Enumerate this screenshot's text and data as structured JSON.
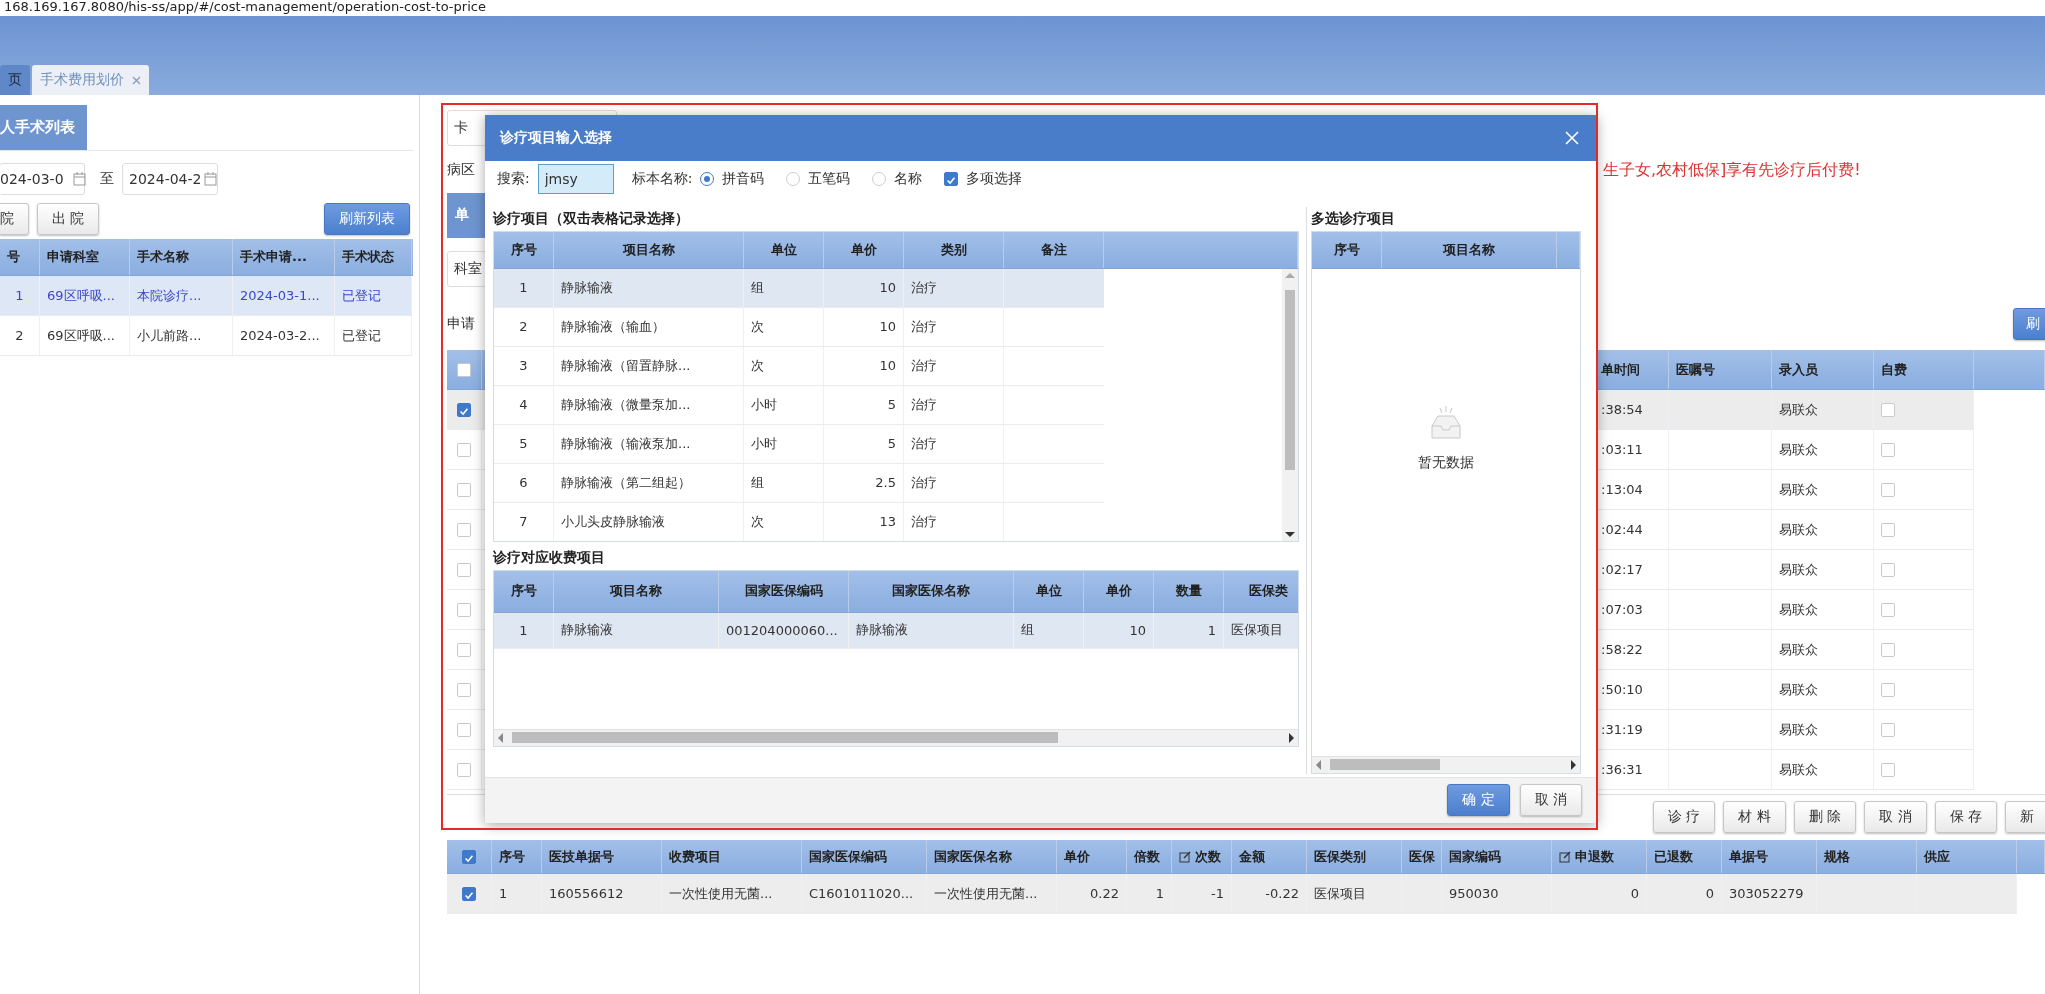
{
  "address_bar": {
    "url": "168.169.167.8080/his-ss/app/#/cost-management/operation-cost-to-price"
  },
  "tabs": [
    {
      "label": "页",
      "selected": false,
      "closable": false
    },
    {
      "label": "手术费用划价",
      "selected": true,
      "closable": true
    }
  ],
  "patient_panel": {
    "title": "人手术列表",
    "date_from": "024-03-0",
    "date_separator": "至",
    "date_to": "2024-04-2",
    "filter_buttons": [
      "院",
      "出 院"
    ],
    "refresh_button": "刷新列表",
    "table": {
      "columns": [
        "号",
        "申请科室",
        "手术名称",
        "手术申请...",
        "手术状态"
      ],
      "rows": [
        {
          "cells": [
            "1",
            "69区呼吸...",
            "本院诊疗...",
            "2024-03-1...",
            "已登记"
          ],
          "selected": true
        },
        {
          "cells": [
            "2",
            "69区呼吸...",
            "小儿前路...",
            "2024-03-2...",
            "已登记"
          ],
          "selected": false
        }
      ]
    }
  },
  "billing": {
    "card_field": "卡",
    "ward_label": "病区",
    "notice": "生子女,农村低保]享有先诊疗后付费!",
    "section_tab": "单",
    "dept_field": "科室",
    "apply_label": "申请",
    "refresh_button": "刷",
    "records": {
      "all_checked": false,
      "columns": [
        "单时间",
        "医嘱号",
        "录入员",
        "自费"
      ],
      "rows": [
        {
          "checked": true,
          "selected": true,
          "time": ":38:54",
          "recorder": "易联众",
          "self_pay": false
        },
        {
          "checked": false,
          "selected": false,
          "time": ":03:11",
          "recorder": "易联众",
          "self_pay": false
        },
        {
          "checked": false,
          "selected": false,
          "time": ":13:04",
          "recorder": "易联众",
          "self_pay": false
        },
        {
          "checked": false,
          "selected": false,
          "time": ":02:44",
          "recorder": "易联众",
          "self_pay": false
        },
        {
          "checked": false,
          "selected": false,
          "time": ":02:17",
          "recorder": "易联众",
          "self_pay": false
        },
        {
          "checked": false,
          "selected": false,
          "time": ":07:03",
          "recorder": "易联众",
          "self_pay": false
        },
        {
          "checked": false,
          "selected": false,
          "time": ":58:22",
          "recorder": "易联众",
          "self_pay": false
        },
        {
          "checked": false,
          "selected": false,
          "time": ":50:10",
          "recorder": "易联众",
          "self_pay": false
        },
        {
          "checked": false,
          "selected": false,
          "time": ":31:19",
          "recorder": "易联众",
          "self_pay": false
        },
        {
          "checked": false,
          "selected": false,
          "time": ":36:31",
          "recorder": "易联众",
          "self_pay": false
        }
      ]
    },
    "action_buttons": [
      "诊 疗",
      "材 料",
      "删 除",
      "取 消",
      "保 存",
      "新"
    ],
    "charges": {
      "all_checked": true,
      "columns": [
        {
          "label": "序号",
          "editable": false
        },
        {
          "label": "医技单据号",
          "editable": false
        },
        {
          "label": "收费项目",
          "editable": false
        },
        {
          "label": "国家医保编码",
          "editable": false
        },
        {
          "label": "国家医保名称",
          "editable": false
        },
        {
          "label": "单价",
          "editable": false
        },
        {
          "label": "倍数",
          "editable": false
        },
        {
          "label": "次数",
          "editable": true
        },
        {
          "label": "金额",
          "editable": false
        },
        {
          "label": "医保类别",
          "editable": false
        },
        {
          "label": "医保",
          "editable": false
        },
        {
          "label": "国家编码",
          "editable": false
        },
        {
          "label": "申退数",
          "editable": true
        },
        {
          "label": "已退数",
          "editable": false
        },
        {
          "label": "单据号",
          "editable": false
        },
        {
          "label": "规格",
          "editable": false
        },
        {
          "label": "供应",
          "editable": false
        }
      ],
      "rows": [
        {
          "checked": true,
          "selected": true,
          "cells": [
            "1",
            "160556612",
            "一次性使用无菌...",
            "C1601011020...",
            "一次性使用无菌...",
            "0.22",
            "1",
            "-1",
            "-0.22",
            "医保项目",
            null,
            "950030",
            "0",
            "0",
            "303052279",
            null,
            null
          ]
        }
      ]
    }
  },
  "dialog": {
    "title": "诊疗项目输入选择",
    "search_label": "搜索:",
    "search_value": "jmsy",
    "match_label": "标本名称:",
    "match_options": [
      {
        "label": "拼音码",
        "selected": true
      },
      {
        "label": "五笔码",
        "selected": false
      },
      {
        "label": "名称",
        "selected": false
      }
    ],
    "multi_select": {
      "label": "多项选择",
      "checked": true
    },
    "items": {
      "title": "诊疗项目（双击表格记录选择）",
      "columns": [
        "序号",
        "项目名称",
        "单位",
        "单价",
        "类别",
        "备注"
      ],
      "rows": [
        {
          "cells": [
            "1",
            "静脉输液",
            "组",
            "10",
            "治疗"
          ],
          "selected": true
        },
        {
          "cells": [
            "2",
            "静脉输液（输血）",
            "次",
            "10",
            "治疗"
          ],
          "selected": false
        },
        {
          "cells": [
            "3",
            "静脉输液（留置静脉...",
            "次",
            "10",
            "治疗"
          ],
          "selected": false
        },
        {
          "cells": [
            "4",
            "静脉输液（微量泵加...",
            "小时",
            "5",
            "治疗"
          ],
          "selected": false
        },
        {
          "cells": [
            "5",
            "静脉输液（输液泵加...",
            "小时",
            "5",
            "治疗"
          ],
          "selected": false
        },
        {
          "cells": [
            "6",
            "静脉输液（第二组起）",
            "组",
            "2.5",
            "治疗"
          ],
          "selected": false
        },
        {
          "cells": [
            "7",
            "小儿头皮静脉输液",
            "次",
            "13",
            "治疗"
          ],
          "selected": false
        }
      ]
    },
    "multi": {
      "title": "多选诊疗项目",
      "columns": [
        "序号",
        "项目名称"
      ],
      "empty_text": "暂无数据"
    },
    "charges": {
      "title": "诊疗对应收费项目",
      "columns": [
        "序号",
        "项目名称",
        "国家医保编码",
        "国家医保名称",
        "单位",
        "单价",
        "数量",
        "医保类"
      ],
      "rows": [
        {
          "cells": [
            "1",
            "静脉输液",
            "001204000060...",
            "静脉输液",
            "组",
            "10",
            "1",
            "医保项目"
          ],
          "selected": true
        }
      ]
    },
    "buttons": [
      {
        "label": "确 定",
        "kind": "primary"
      },
      {
        "label": "取 消",
        "kind": "default"
      }
    ]
  }
}
